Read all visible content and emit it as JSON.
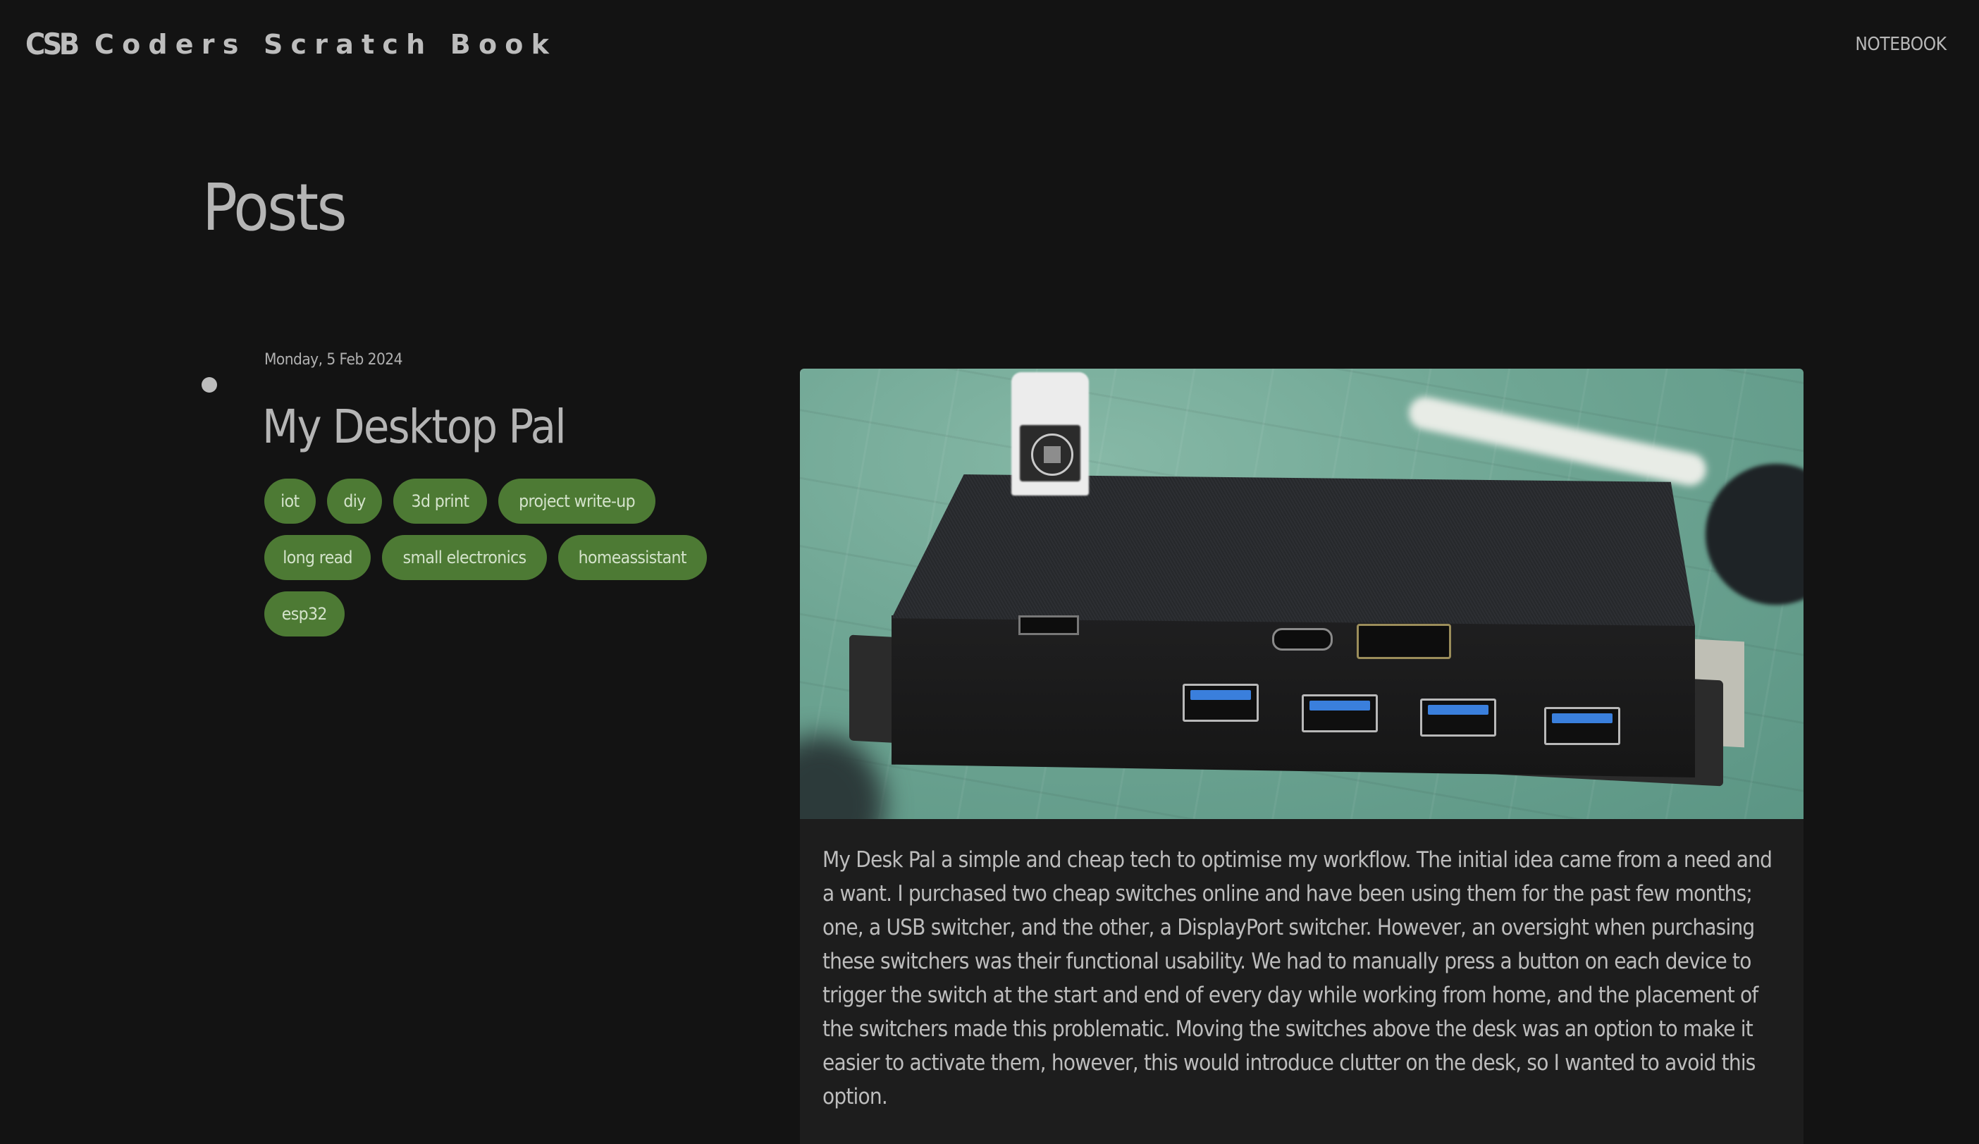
{
  "nav": {
    "logo": "CSB",
    "brand": "Coders Scratch Book",
    "links": [
      {
        "label": "NOTEBOOK"
      }
    ]
  },
  "page": {
    "title": "Posts"
  },
  "posts": [
    {
      "date": "Monday, 5 Feb 2024",
      "title": "My Desktop Pal",
      "tags": [
        "iot",
        "diy",
        "3d print",
        "project write-up",
        "long read",
        "small electronics",
        "homeassistant",
        "esp32"
      ],
      "image_alt": "3D-printed black enclosure with USB-C, DisplayPort and four USB ports on a green cutting mat",
      "excerpt_lines": [
        "My Desk Pal a simple and cheap tech to optimise my workflow. The initial idea came from a need and",
        "a want. I purchased two cheap switches online and have been using them for the past few months;",
        "one, a USB switcher, and the other, a DisplayPort switcher. However, an oversight when purchasing",
        "these switchers was their functional usability. We had to manually press a button on each device to",
        "trigger the switch at the start and end of every day while working from home, and the placement of",
        "the switchers made this problematic. Moving the switches above the desk was an option to make it",
        "easier to activate them, however, this would introduce clutter on the desk, so I wanted to avoid this",
        "option."
      ]
    }
  ],
  "colors": {
    "background": "#131313",
    "card": "#1d1d1d",
    "text": "#bdbdbd",
    "tag_bg": "#4d7a34",
    "tag_text": "#d4e3cb"
  }
}
